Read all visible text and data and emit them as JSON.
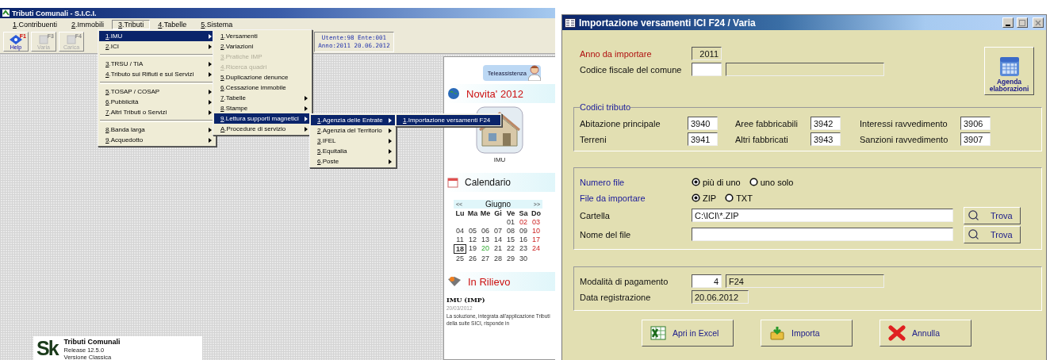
{
  "app_window": {
    "title": "Tributi Comunali - S.I.C.I.",
    "menu_bar": [
      {
        "label": "1.Contribuenti",
        "selected": false
      },
      {
        "label": "2.Immobili",
        "selected": false
      },
      {
        "label": "3.Tributi",
        "selected": true
      },
      {
        "label": "4.Tabelle",
        "selected": false
      },
      {
        "label": "5.Sistema",
        "selected": false
      }
    ],
    "toolbar": [
      {
        "key": "F1",
        "label": "Help",
        "disabled": false
      },
      {
        "key": "F3",
        "label": "Varia",
        "disabled": true
      },
      {
        "key": "F4",
        "label": "Carica",
        "disabled": true
      }
    ],
    "status_box": [
      "Utente:98  Ente:001",
      "Anno:2011 20.06.2012"
    ],
    "menus": [
      {
        "items": [
          {
            "kind": "item",
            "label": "1.IMU",
            "selected": true,
            "disabled": false,
            "has_submenu": true
          },
          {
            "kind": "item",
            "label": "2.ICI",
            "selected": false,
            "disabled": false,
            "has_submenu": true
          },
          {
            "kind": "separator"
          },
          {
            "kind": "item",
            "label": "3.TRSU / TIA",
            "selected": false,
            "disabled": false,
            "has_submenu": true
          },
          {
            "kind": "item",
            "label": "4.Tributo sui Rifiuti e sui Servizi",
            "selected": false,
            "disabled": false,
            "has_submenu": true
          },
          {
            "kind": "separator"
          },
          {
            "kind": "item",
            "label": "5.TOSAP / COSAP",
            "selected": false,
            "disabled": false,
            "has_submenu": true
          },
          {
            "kind": "item",
            "label": "6.Pubblicità",
            "selected": false,
            "disabled": false,
            "has_submenu": true
          },
          {
            "kind": "item",
            "label": "7.Altri Tributi o Servizi",
            "selected": false,
            "disabled": false,
            "has_submenu": true
          },
          {
            "kind": "separator"
          },
          {
            "kind": "item",
            "label": "8.Banda larga",
            "selected": false,
            "disabled": false,
            "has_submenu": true
          },
          {
            "kind": "item",
            "label": "9.Acquedotto",
            "selected": false,
            "disabled": false,
            "has_submenu": true
          }
        ]
      },
      {
        "items": [
          {
            "kind": "item",
            "label": "1.Versamenti",
            "selected": false,
            "disabled": false,
            "has_submenu": false
          },
          {
            "kind": "item",
            "label": "2.Variazioni",
            "selected": false,
            "disabled": false,
            "has_submenu": false
          },
          {
            "kind": "item",
            "label": "3.Pratiche IMP",
            "selected": false,
            "disabled": true,
            "has_submenu": false
          },
          {
            "kind": "item",
            "label": "4.Ricerca quadri",
            "selected": false,
            "disabled": true,
            "has_submenu": false
          },
          {
            "kind": "item",
            "label": "5.Duplicazione denunce",
            "selected": false,
            "disabled": false,
            "has_submenu": false
          },
          {
            "kind": "item",
            "label": "6.Cessazione immobile",
            "selected": false,
            "disabled": false,
            "has_submenu": false
          },
          {
            "kind": "item",
            "label": "7.Tabelle",
            "selected": false,
            "disabled": false,
            "has_submenu": true
          },
          {
            "kind": "item",
            "label": "8.Stampe",
            "selected": false,
            "disabled": false,
            "has_submenu": true
          },
          {
            "kind": "item",
            "label": "9.Lettura supporti magnetici",
            "selected": true,
            "disabled": false,
            "has_submenu": true
          },
          {
            "kind": "item",
            "label": "A.Procedure di servizio",
            "selected": false,
            "disabled": false,
            "has_submenu": true
          }
        ]
      },
      {
        "items": [
          {
            "kind": "item",
            "label": "1.Agenzia delle Entrate",
            "selected": true,
            "disabled": false,
            "has_submenu": true
          },
          {
            "kind": "item",
            "label": "2.Agenzia del Territorio",
            "selected": false,
            "disabled": false,
            "has_submenu": true
          },
          {
            "kind": "item",
            "label": "3.IFEL",
            "selected": false,
            "disabled": false,
            "has_submenu": true
          },
          {
            "kind": "item",
            "label": "5.Equitalia",
            "selected": false,
            "disabled": false,
            "has_submenu": true
          },
          {
            "kind": "item",
            "label": "6.Poste",
            "selected": false,
            "disabled": false,
            "has_submenu": true
          }
        ]
      },
      {
        "items": [
          {
            "kind": "item",
            "label": "1.Importazione versamenti F24",
            "selected": true,
            "disabled": false,
            "has_submenu": false
          }
        ]
      }
    ],
    "sidebar": {
      "assist_button": "Teleassistenza",
      "news_title": "Novita' 2012",
      "news_item": "IMU",
      "calendar_title": "Calendario",
      "calendar": {
        "prev": "<<",
        "month": "Giugno",
        "next": ">>",
        "weekdays": [
          "Lu",
          "Ma",
          "Me",
          "Gi",
          "Ve",
          "Sa",
          "Do"
        ],
        "weeks": [
          [
            {
              "kind": "blank"
            },
            {
              "kind": "blank"
            },
            {
              "kind": "blank"
            },
            {
              "kind": "blank"
            },
            {
              "kind": "normal",
              "day": "01",
              "selected": false
            },
            {
              "kind": "holiday",
              "day": "02",
              "selected": false
            },
            {
              "kind": "holiday",
              "day": "03",
              "selected": false
            }
          ],
          [
            {
              "kind": "normal",
              "day": "04",
              "selected": false
            },
            {
              "kind": "normal",
              "day": "05",
              "selected": false
            },
            {
              "kind": "normal",
              "day": "06",
              "selected": false
            },
            {
              "kind": "normal",
              "day": "07",
              "selected": false
            },
            {
              "kind": "normal",
              "day": "08",
              "selected": false
            },
            {
              "kind": "normal",
              "day": "09",
              "selected": false
            },
            {
              "kind": "holiday",
              "day": "10",
              "selected": false
            }
          ],
          [
            {
              "kind": "normal",
              "day": "11",
              "selected": false
            },
            {
              "kind": "normal",
              "day": "12",
              "selected": false
            },
            {
              "kind": "normal",
              "day": "13",
              "selected": false
            },
            {
              "kind": "normal",
              "day": "14",
              "selected": false
            },
            {
              "kind": "normal",
              "day": "15",
              "selected": false
            },
            {
              "kind": "normal",
              "day": "16",
              "selected": false
            },
            {
              "kind": "holiday",
              "day": "17",
              "selected": false
            }
          ],
          [
            {
              "kind": "normal",
              "day": "18",
              "selected": true
            },
            {
              "kind": "normal",
              "day": "19",
              "selected": false
            },
            {
              "kind": "event",
              "day": "20",
              "selected": false
            },
            {
              "kind": "normal",
              "day": "21",
              "selected": false
            },
            {
              "kind": "normal",
              "day": "22",
              "selected": false
            },
            {
              "kind": "normal",
              "day": "23",
              "selected": false
            },
            {
              "kind": "holiday",
              "day": "24",
              "selected": false
            }
          ],
          [
            {
              "kind": "normal",
              "day": "25",
              "selected": false
            },
            {
              "kind": "normal",
              "day": "26",
              "selected": false
            },
            {
              "kind": "normal",
              "day": "27",
              "selected": false
            },
            {
              "kind": "normal",
              "day": "28",
              "selected": false
            },
            {
              "kind": "normal",
              "day": "29",
              "selected": false
            },
            {
              "kind": "normal",
              "day": "30",
              "selected": false
            }
          ]
        ]
      },
      "highlight_title": "In Rilievo",
      "article": {
        "title": "IMU (IMP)",
        "date": "20/03/2012",
        "text": "La soluzione, integrata all'applicazione Tributi della suite SICI, risponde in"
      }
    },
    "about": {
      "logo": "Sk",
      "product": "Tributi Comunali",
      "release": "Release 12.5.0",
      "edition": "Versione Classica"
    }
  },
  "dialog": {
    "title": "Importazione versamenti ICI F24 / Varia",
    "anno": {
      "label": "Anno da importare",
      "value": "2011",
      "disabled": true
    },
    "codice_fiscale": {
      "label": "Codice fiscale del comune",
      "disabled": false
    },
    "agenda_button": "Agenda elaborazioni",
    "codici_tributo": {
      "title": "Codici tributo",
      "fields": [
        {
          "label": "Abitazione principale",
          "value": "3940"
        },
        {
          "label": "Aree fabbricabili",
          "value": "3942"
        },
        {
          "label": "Interessi ravvedimento",
          "value": "3906"
        },
        {
          "label": "Terreni",
          "value": "3941"
        },
        {
          "label": "Altri fabbricati",
          "value": "3943"
        },
        {
          "label": "Sanzioni ravvedimento",
          "value": "3907"
        }
      ]
    },
    "numero_file": {
      "label": "Numero file",
      "options": [
        {
          "label": "più di uno",
          "selected": true
        },
        {
          "label": "uno solo",
          "selected": false
        }
      ]
    },
    "file_da_importare": {
      "label": "File da importare",
      "options": [
        {
          "label": "ZIP",
          "selected": true
        },
        {
          "label": "TXT",
          "selected": false
        }
      ]
    },
    "cartella": {
      "label": "Cartella",
      "value": "C:\\ICI\\*.ZIP",
      "button": "Trova"
    },
    "nome_file": {
      "label": "Nome del file",
      "button": "Trova"
    },
    "modalita": {
      "label": "Modalità di pagamento",
      "code": "4",
      "description": "F24"
    },
    "data_registrazione": {
      "label": "Data registrazione",
      "value": "20.06.2012"
    },
    "buttons": [
      {
        "kind": "excel",
        "label": "Apri in Excel"
      },
      {
        "kind": "import",
        "label": "Importa"
      },
      {
        "kind": "cancel",
        "label": "Annulla"
      }
    ]
  }
}
